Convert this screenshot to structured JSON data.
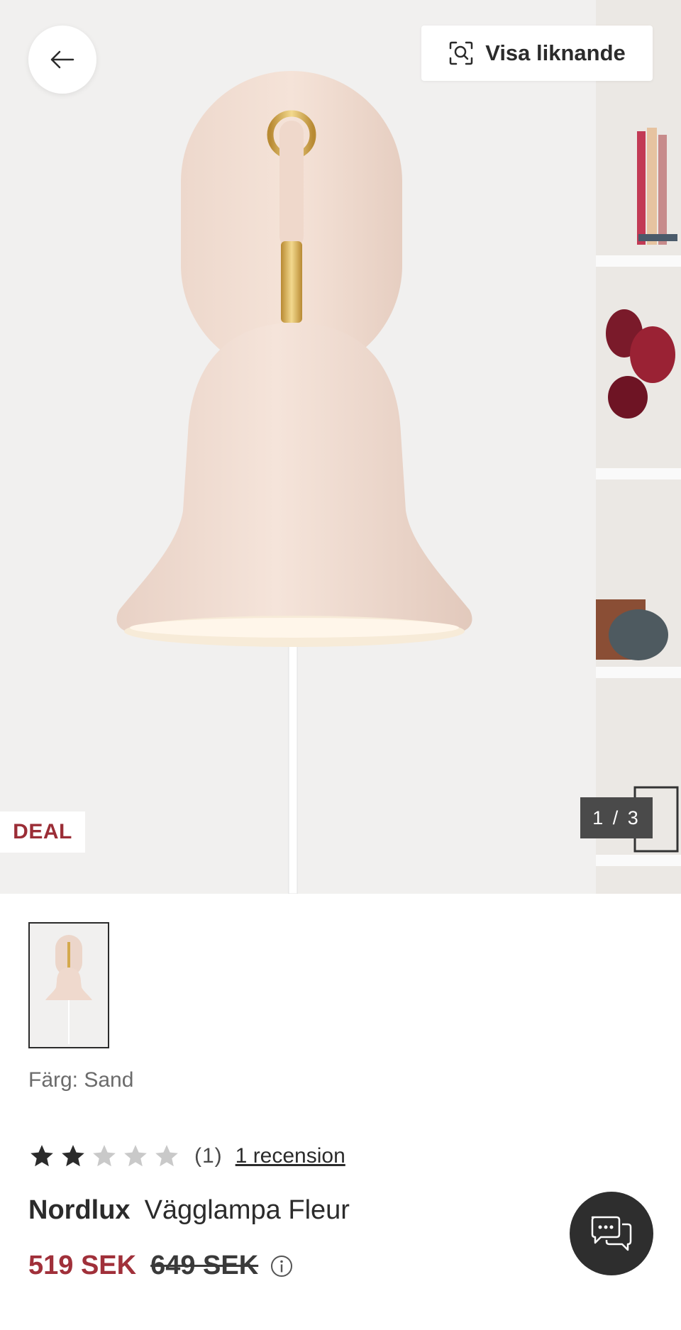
{
  "hero": {
    "similar_label": "Visa liknande",
    "deal_label": "DEAL",
    "counter": "1 / 3"
  },
  "product": {
    "color_label": "Färg: Sand",
    "rating": {
      "score": 2,
      "max": 5,
      "count_text": "(1)",
      "review_link": "1 recension"
    },
    "brand": "Nordlux",
    "name": "Vägglampa Fleur",
    "price_now": "519 SEK",
    "price_old": "649 SEK"
  },
  "colors": {
    "accent": "#a0303a",
    "lamp": "#f0ddd3",
    "brass": "#d4a94d"
  },
  "icons": [
    "back-arrow-icon",
    "visual-search-icon",
    "info-icon",
    "chat-icon",
    "star-icon"
  ]
}
